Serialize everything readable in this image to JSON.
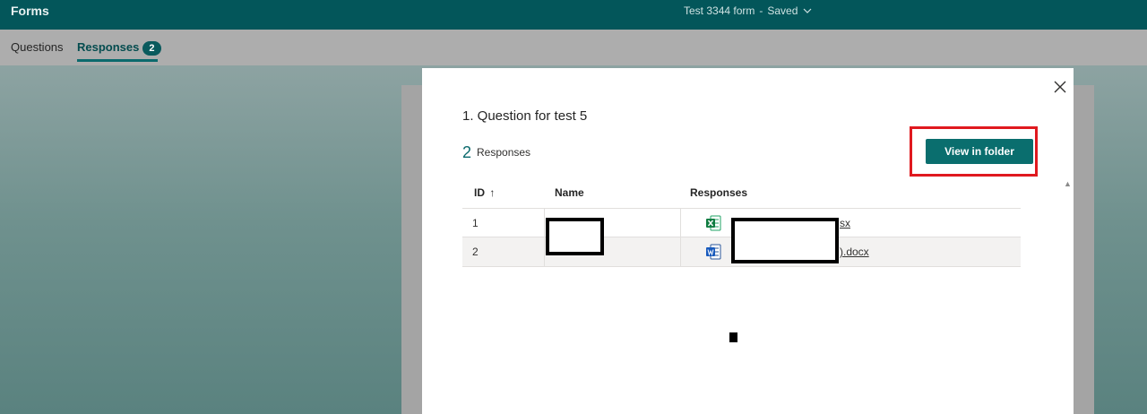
{
  "header": {
    "app_name": "Forms",
    "form_title": "Test 3344 form",
    "separator": "-",
    "save_status": "Saved"
  },
  "tabs": [
    {
      "label": "Questions"
    },
    {
      "label": "Responses",
      "badge": "2"
    }
  ],
  "dialog": {
    "question": "1.  Question for test 5",
    "response_count": "2",
    "responses_label": "Responses",
    "view_button": "View in folder",
    "table": {
      "columns": [
        "ID",
        "Name",
        "Responses"
      ],
      "sort_indicator": "↑",
      "rows": [
        {
          "id": "1",
          "file_suffix": "sx",
          "file_type": "excel"
        },
        {
          "id": "2",
          "file_suffix": ").docx",
          "file_type": "word"
        }
      ]
    }
  },
  "colors": {
    "brand": "#03565a",
    "accent": "#0a6e6e",
    "highlight": "#e0191f"
  },
  "icons": [
    "chevron-down-icon",
    "close-icon",
    "excel-file-icon",
    "word-file-icon",
    "sort-up-icon"
  ]
}
